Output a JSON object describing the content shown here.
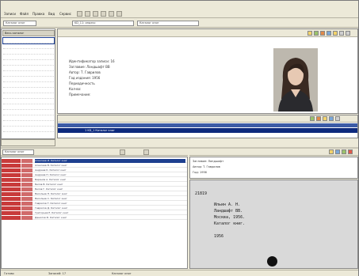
{
  "menubar": {
    "items": [
      "Записи",
      "Файл",
      "Правка",
      "Вид",
      "Сервис"
    ]
  },
  "addressbar": {
    "field1": "Каталог книг",
    "field2": "KD_11: индекс",
    "field3": "Каталог книг"
  },
  "tree": {
    "header": "Весь каталог",
    "rows": [
      "",
      "",
      "",
      "",
      "",
      "",
      "",
      "",
      "",
      "",
      "",
      "",
      "",
      "",
      "",
      "",
      ""
    ]
  },
  "record": {
    "lines": [
      "Идентификатор записи: 16",
      "Заглавие: Ландшафт ВВ",
      "Автор: Т. Гаврилов",
      "Год издания: 1956",
      "Периодичность",
      "Кол-во:",
      "Примечание:"
    ]
  },
  "strip": {
    "row_text": "1 KD_1 Каталог книг",
    "tools_label": ""
  },
  "leftbottom": {
    "label": ""
  },
  "listbar": {
    "label": "Каталог книг"
  },
  "list": {
    "rows": [
      {
        "text": "Алексеев И. Каталог книг"
      },
      {
        "text": "Алексеев В. Каталог книг"
      },
      {
        "text": "Андреев К. Каталог книг"
      },
      {
        "text": "Андреев Н. Каталог книг"
      },
      {
        "text": "Баранов А. Каталог книг"
      },
      {
        "text": "Белов В. Каталог книг"
      },
      {
        "text": "Белов Г. Каталог книг"
      },
      {
        "text": "Васильев П. Каталог книг"
      },
      {
        "text": "Васильев С. Каталог книг"
      },
      {
        "text": "Гаврилов Т. Каталог книг"
      },
      {
        "text": "Гаврилов Д. Каталог книг"
      },
      {
        "text": "Григорьев Е. Каталог книг"
      },
      {
        "text": "Данилов Ф. Каталог книг"
      }
    ],
    "selected_index": 0
  },
  "card": {
    "meta_lines": [
      "Заглавие: Ландшафт",
      "Автор: Т. Гаврилов",
      "Год: 1956"
    ],
    "index": "21819",
    "lines": [
      "Ильин А. Н.",
      "Ландшафт ВВ.",
      "Москва, 1956.",
      "Каталог книг.",
      "",
      "1956"
    ]
  },
  "statusbar": {
    "cells": [
      "Готово",
      "Записей: 17",
      "Каталог книг"
    ]
  },
  "colors": {
    "selection": "#1d3f8f",
    "list_marker": "#c83a3a",
    "chrome": "#ece9d8"
  }
}
